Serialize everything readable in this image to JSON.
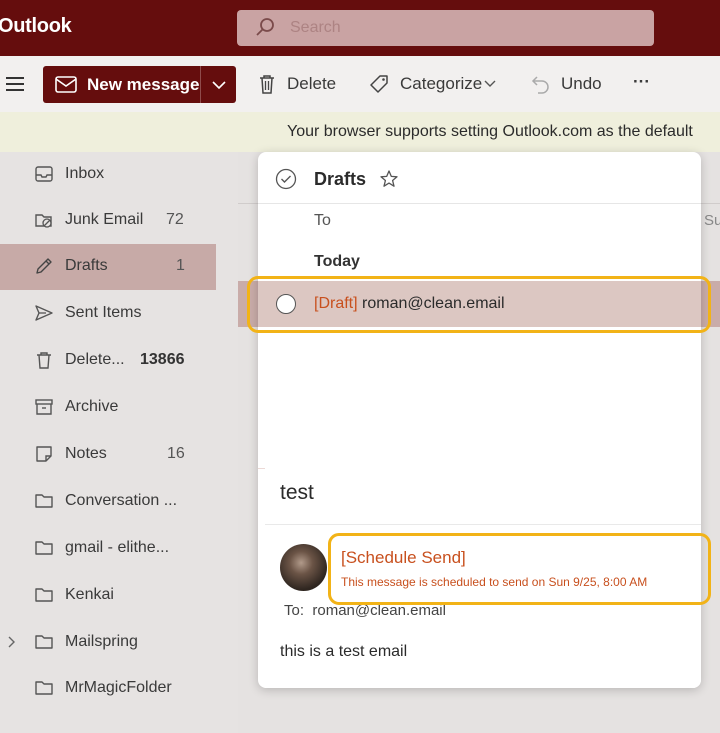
{
  "app": {
    "title": "Outlook",
    "search_placeholder": "Search"
  },
  "toolbar": {
    "new_message": "New message",
    "delete": "Delete",
    "categorize": "Categorize",
    "undo": "Undo",
    "more": "···"
  },
  "banner": {
    "text": "Your browser supports setting Outlook.com as the default"
  },
  "sidebar": {
    "items": [
      {
        "label": "Inbox",
        "count": "",
        "icon": "inbox-icon"
      },
      {
        "label": "Junk Email",
        "count": "72",
        "icon": "junk-icon"
      },
      {
        "label": "Drafts",
        "count": "1",
        "icon": "pencil-icon",
        "active": true
      },
      {
        "label": "Sent Items",
        "count": "",
        "icon": "send-icon"
      },
      {
        "label": "Delete...",
        "count": "13866",
        "icon": "trash-icon"
      },
      {
        "label": "Archive",
        "count": "",
        "icon": "archive-icon"
      },
      {
        "label": "Notes",
        "count": "16",
        "icon": "note-icon"
      },
      {
        "label": "Conversation ...",
        "count": "",
        "icon": "folder-icon"
      },
      {
        "label": "gmail - elithe...",
        "count": "",
        "icon": "folder-icon"
      },
      {
        "label": "Kenkai",
        "count": "",
        "icon": "folder-icon"
      },
      {
        "label": "Mailspring",
        "count": "",
        "icon": "folder-icon",
        "expandable": true
      },
      {
        "label": "MrMagicFolder",
        "count": "",
        "icon": "folder-icon"
      }
    ]
  },
  "list": {
    "folder_title": "Drafts",
    "to_header": "To",
    "group": "Today",
    "bg_header_fragment": "Su",
    "draft": {
      "tag": "[Draft]",
      "address": "roman@clean.email"
    }
  },
  "message": {
    "subject": "test",
    "schedule_title": "[Schedule Send]",
    "schedule_note": "This message is scheduled to send on Sun 9/25, 8:00 AM",
    "to_label": "To:",
    "to_address": "roman@clean.email",
    "body": "this is a test email"
  },
  "colors": {
    "brand": "#650d0d",
    "highlight": "#f2b317",
    "accent_text": "#c8501e",
    "active_nav": "#c7aaa7"
  }
}
